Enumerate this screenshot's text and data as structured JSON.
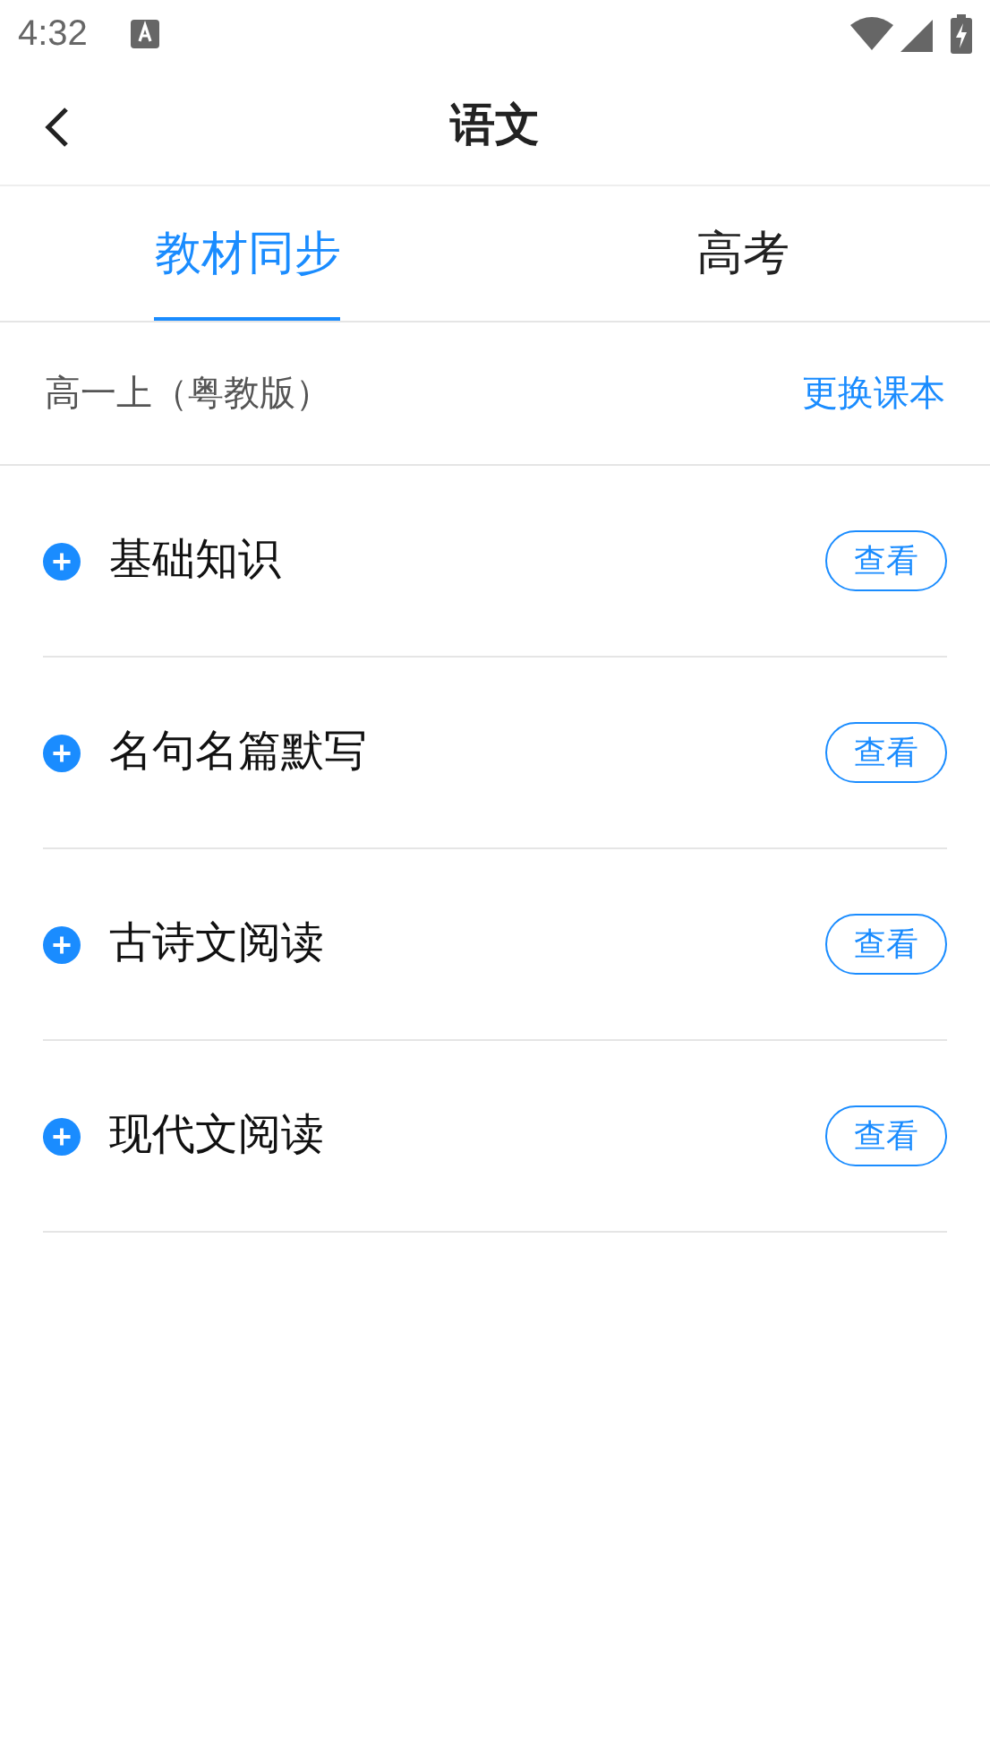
{
  "status_bar": {
    "time": "4:32"
  },
  "header": {
    "title": "语文"
  },
  "tabs": [
    {
      "label": "教材同步",
      "selected": true
    },
    {
      "label": "高考",
      "selected": false
    }
  ],
  "textbook": {
    "name": "高一上（粤教版）",
    "action": "更换课本"
  },
  "sections": [
    {
      "title": "基础知识",
      "button": "查看",
      "expanded": false
    },
    {
      "title": "名句名篇默写",
      "button": "查看",
      "expanded": false
    },
    {
      "title": "古诗文阅读",
      "button": "查看",
      "expanded": false
    },
    {
      "title": "现代文阅读",
      "button": "查看",
      "expanded": false
    }
  ]
}
